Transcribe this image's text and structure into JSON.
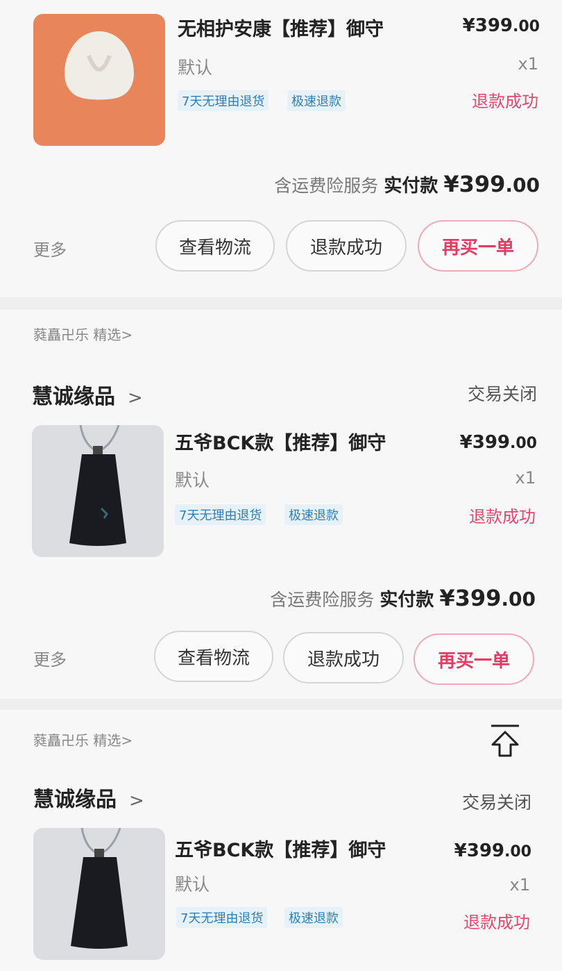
{
  "orders": [
    {
      "title": "无相护安康【推荐】御守",
      "price_main": "¥399",
      "price_cents": ".00",
      "spec": "默认",
      "qty": "x1",
      "tags": [
        "7天无理由退货",
        "极速退款"
      ],
      "item_status": "退款成功",
      "note": "含运费险服务",
      "paid_label": "实付款",
      "paid_main": "¥399",
      "paid_cents": ".00",
      "more": "更多",
      "buttons": [
        "查看物流",
        "退款成功",
        "再买一单"
      ],
      "thumb_color": "#e8855a"
    },
    {
      "shop_sub": "蕤矗卍乐 精选>",
      "shop_name": "慧诚缘品",
      "shop_chevron": ">",
      "order_status": "交易关闭",
      "title": "五爷BCK款【推荐】御守",
      "price_main": "¥399",
      "price_cents": ".00",
      "spec": "默认",
      "qty": "x1",
      "tags": [
        "7天无理由退货",
        "极速退款"
      ],
      "item_status": "退款成功",
      "note": "含运费险服务",
      "paid_label": "实付款",
      "paid_main": "¥399",
      "paid_cents": ".00",
      "more": "更多",
      "buttons": [
        "查看物流",
        "退款成功",
        "再买一单"
      ]
    },
    {
      "shop_sub": "蕤矗卍乐 精选>",
      "shop_name": "慧诚缘品",
      "shop_chevron": ">",
      "order_status": "交易关闭",
      "title": "五爷BCK款【推荐】御守",
      "price_main": "¥399",
      "price_cents": ".00",
      "spec": "默认",
      "qty": "x1",
      "tags": [
        "7天无理由退货",
        "极速退款"
      ],
      "item_status": "退款成功"
    }
  ],
  "icons": {
    "back_to_top": "back-to-top-icon"
  },
  "colors": {
    "accent": "#e23c62",
    "tag_text": "#2f7fb6"
  }
}
